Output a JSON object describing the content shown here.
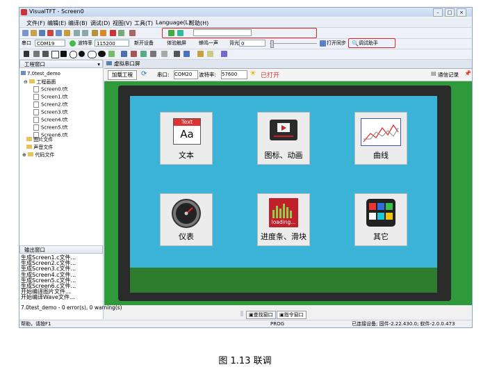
{
  "window": {
    "title": "VisualTFT - Screen0"
  },
  "menu": [
    "文件(F)",
    "编辑(E)",
    "编译(B)",
    "调试(D)",
    "视图(V)",
    "工具(T)",
    "Language(L)",
    "帮助(H)"
  ],
  "serial_toolbar": {
    "port_label": "串口",
    "port_value": "COM19",
    "baud_label": "波特率",
    "baud_value": "115200",
    "new_device": "新开设备",
    "experience_touch": "体验触屏",
    "beep": "蜂鸣一声",
    "backlight_label": "背光",
    "backlight_value": "0",
    "sync_label": "打开同步",
    "debug_helper": "调试助手"
  },
  "left_panel": {
    "title": "工程窗口",
    "project": "7.0test_demo",
    "project_screen_folder": "工程画面",
    "screens": [
      "Screen0.tft",
      "Screen1.tft",
      "Screen2.tft",
      "Screen3.tft",
      "Screen4.tft",
      "Screen5.tft",
      "Screen6.tft"
    ],
    "folders": [
      "图片文件",
      "声音文件",
      "代码文件"
    ]
  },
  "output_panel": {
    "title": "输出窗口",
    "lines": [
      "生成Screen1.c文件...",
      "生成Screen2.c文件...",
      "生成Screen3.c文件...",
      "生成Screen4.c文件...",
      "生成Screen5.c文件...",
      "生成Screen6.c文件...",
      "开始编译图片文件...",
      "开始编译Wave文件..."
    ],
    "summary": "7.0test_demo - 0 error(s), 0 warning(s)"
  },
  "virtual_serial": {
    "title": "虚拟串口屏",
    "load_project": "加载工程",
    "port_label": "串口:",
    "port_value": "COM20",
    "baud_label": "波特率:",
    "baud_value": "57600",
    "status": "已打开",
    "comm_log": "通信记录"
  },
  "tiles": [
    {
      "label": "文本",
      "icon": "text-icon",
      "badge": "Text",
      "glyph": "Aa"
    },
    {
      "label": "图标、动画",
      "icon": "video-icon"
    },
    {
      "label": "曲线",
      "icon": "curve-icon"
    },
    {
      "label": "仪表",
      "icon": "gauge-icon"
    },
    {
      "label": "进度条、滑块",
      "icon": "progress-icon",
      "badge": "loading..."
    },
    {
      "label": "其它",
      "icon": "grid-icon"
    }
  ],
  "bottom_tabs": [
    "查找窗口",
    "指令窗口"
  ],
  "status": {
    "help": "帮助，请按F1",
    "mode": "PROG",
    "device": "已连接设备; 固件-2.22.430.0; 软件-2.0.0.473"
  },
  "caption": "图 1.13 联调",
  "colors": {
    "screen": "#3bb3d6",
    "sim_bg": "#2f9a3a",
    "highlight": "#dd2222"
  }
}
